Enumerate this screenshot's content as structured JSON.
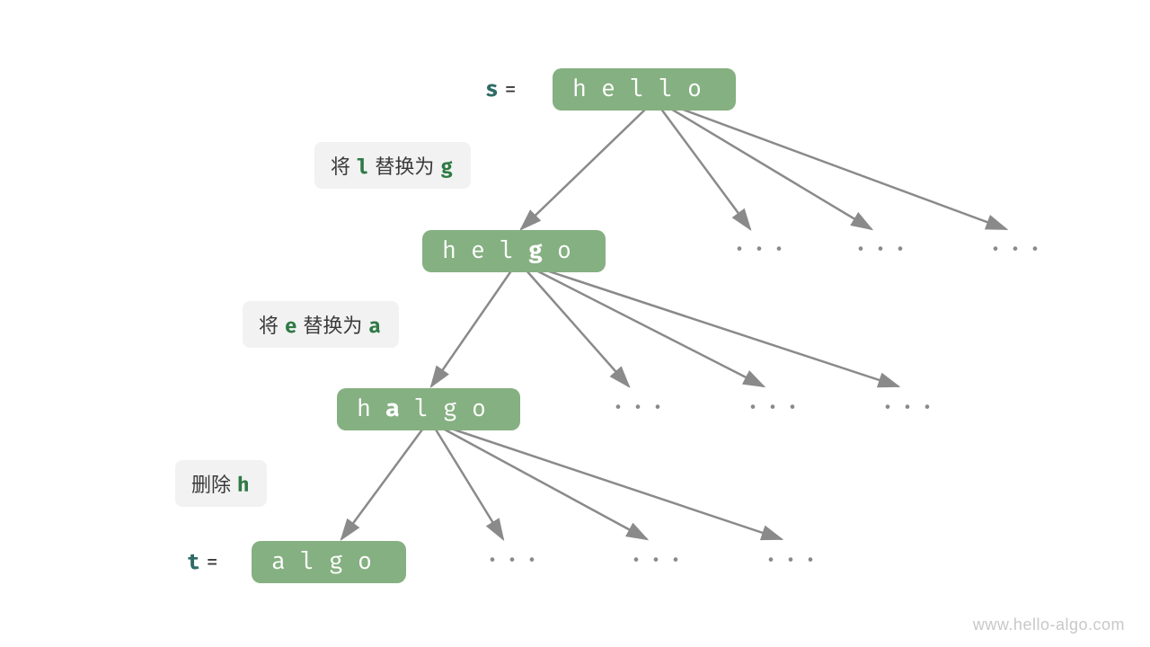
{
  "nodes": {
    "hello": {
      "chars": [
        "h",
        "e",
        "l",
        "l",
        "o"
      ],
      "bold_index": -1
    },
    "helgo": {
      "chars": [
        "h",
        "e",
        "l",
        "g",
        "o"
      ],
      "bold_index": 3
    },
    "halgo": {
      "chars": [
        "h",
        "a",
        "l",
        "g",
        "o"
      ],
      "bold_index": 1
    },
    "algo": {
      "chars": [
        "a",
        "l",
        "g",
        "o"
      ],
      "bold_index": -1
    }
  },
  "labels": {
    "s_var": "s",
    "t_var": "t",
    "eq": "="
  },
  "ops": {
    "op1": {
      "prefix": "将 ",
      "code1": "l",
      "mid": " 替换为 ",
      "code2": "g",
      "suffix": ""
    },
    "op2": {
      "prefix": "将 ",
      "code1": "e",
      "mid": " 替换为 ",
      "code2": "a",
      "suffix": ""
    },
    "op3": {
      "prefix": "删除 ",
      "code1": "h",
      "mid": "",
      "code2": "",
      "suffix": ""
    }
  },
  "ellipsis": "···",
  "watermark": "www.hello-algo.com",
  "colors": {
    "node_bg": "#85b081",
    "op_bg": "#f2f2f2",
    "var": "#2f6b66",
    "code": "#2f7a46",
    "arrow": "#8a8a8a",
    "dots": "#8a8a8a"
  }
}
